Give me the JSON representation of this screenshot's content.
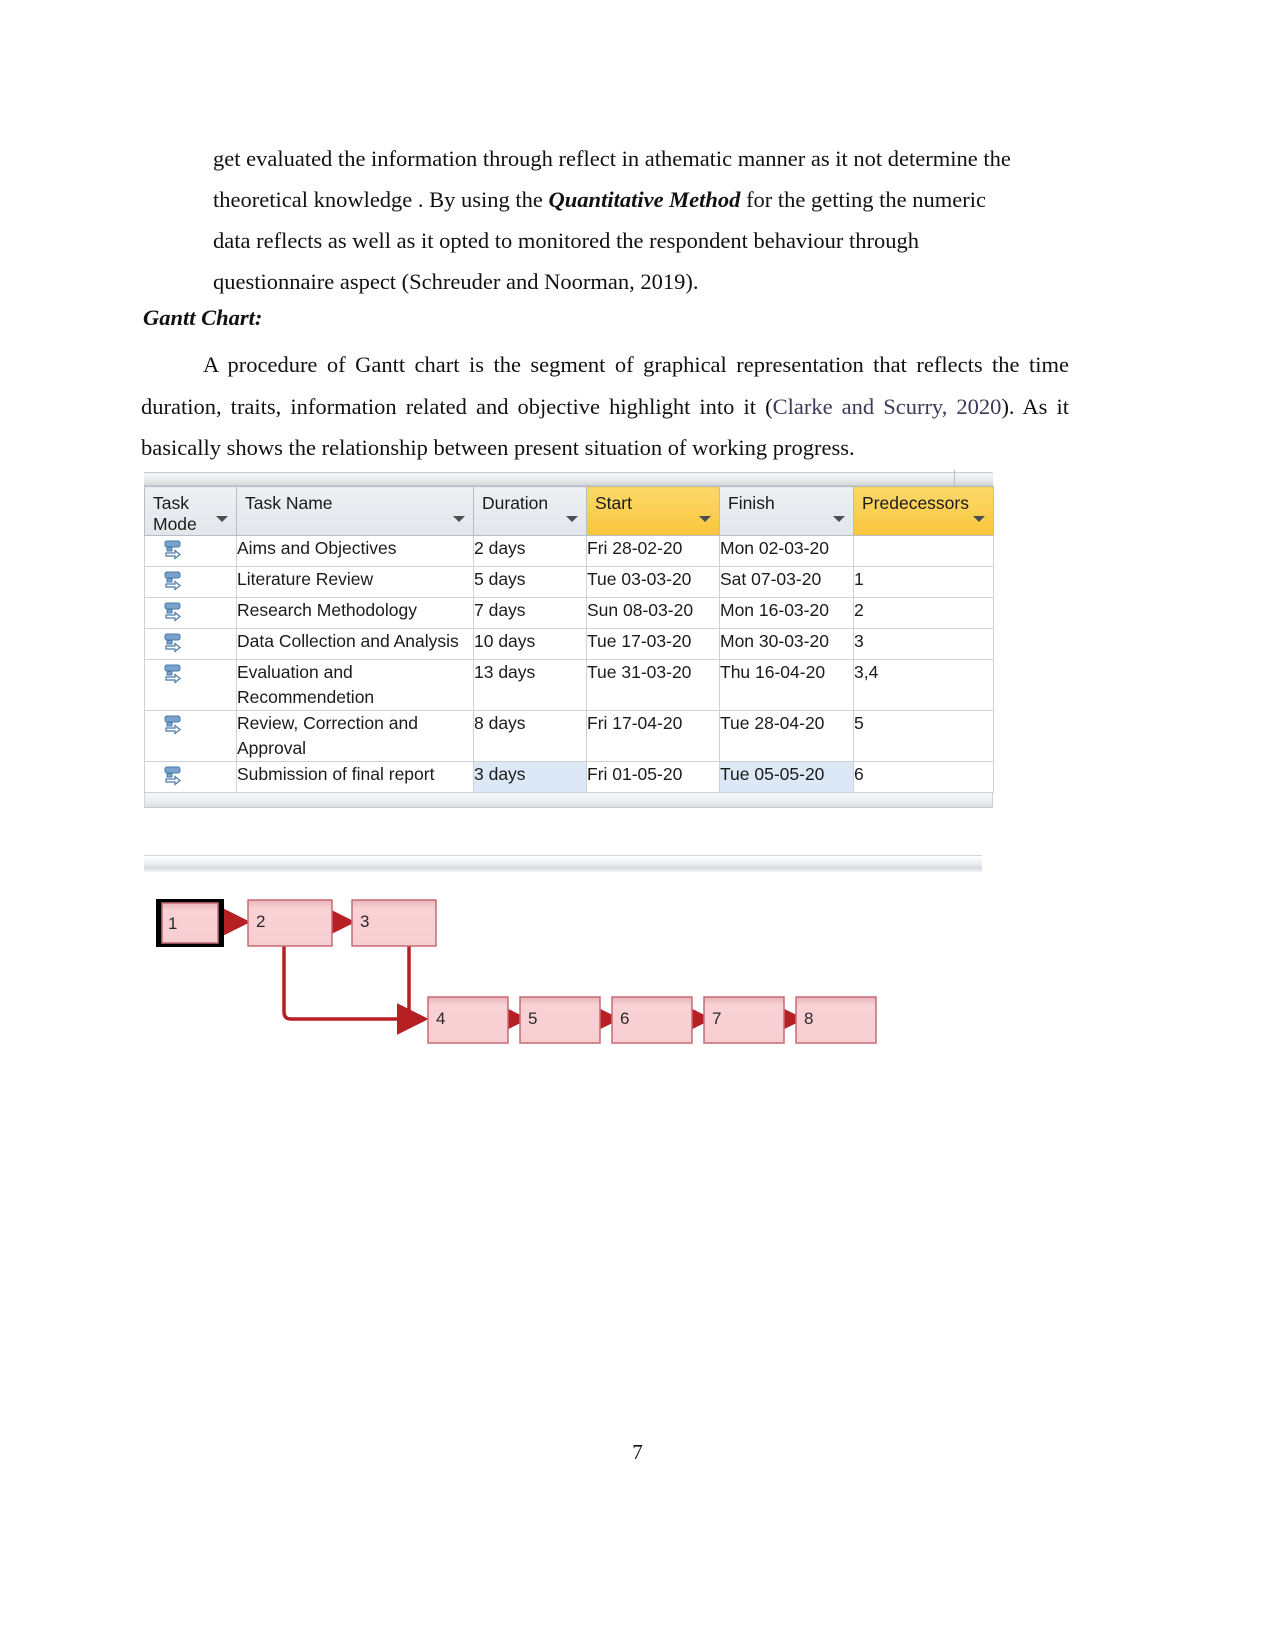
{
  "document": {
    "page_number": "7",
    "paragraph_1": {
      "line_1": "get evaluated the information through reflect in athematic manner as it not determine the",
      "line_2_pre": "theoretical knowledge . By using the ",
      "line_2_bold": "Quantitative Method",
      "line_2_post": " for the getting the numeric",
      "line_3": "data reflects as well as it opted to monitored the respondent behaviour through",
      "line_4": "questionnaire aspect (Schreuder and Noorman, 2019)."
    },
    "heading": "Gantt Chart:",
    "paragraph_2": {
      "text_pre": "A procedure of Gantt chart is the segment of graphical representation that reflects the time duration, traits, information related and objective highlight into it (",
      "citation": "Clarke and Scurry, 2020",
      "text_post": "). As it basically shows the relationship between present situation of working progress."
    }
  },
  "project_table": {
    "columns": [
      {
        "label": "Task\nMode",
        "highlight": false,
        "has_filter": true
      },
      {
        "label": "Task Name",
        "highlight": false,
        "has_filter": true
      },
      {
        "label": "Duration",
        "highlight": false,
        "has_filter": true
      },
      {
        "label": "Start",
        "highlight": true,
        "has_filter": true
      },
      {
        "label": "Finish",
        "highlight": false,
        "has_filter": true
      },
      {
        "label": "Predecessors",
        "highlight": true,
        "has_filter": true
      }
    ],
    "rows": [
      {
        "mode_icon": "auto-schedule-icon",
        "name": "Aims and Objectives",
        "duration": "2 days",
        "start": "Fri 28-02-20",
        "finish": "Mon 02-03-20",
        "predecessors": ""
      },
      {
        "mode_icon": "auto-schedule-icon",
        "name": "Literature Review",
        "duration": "5 days",
        "start": "Tue 03-03-20",
        "finish": "Sat 07-03-20",
        "predecessors": "1"
      },
      {
        "mode_icon": "auto-schedule-icon",
        "name": "Research Methodology",
        "duration": "7 days",
        "start": "Sun 08-03-20",
        "finish": "Mon 16-03-20",
        "predecessors": "2"
      },
      {
        "mode_icon": "auto-schedule-icon",
        "name": "Data Collection and Analysis",
        "duration": "10 days",
        "start": "Tue 17-03-20",
        "finish": "Mon 30-03-20",
        "predecessors": "3"
      },
      {
        "mode_icon": "auto-schedule-icon",
        "name": "Evaluation and Recommendetion",
        "duration": "13 days",
        "start": "Tue 31-03-20",
        "finish": "Thu 16-04-20",
        "predecessors": "3,4"
      },
      {
        "mode_icon": "auto-schedule-icon",
        "name": "Review, Correction and Approval",
        "duration": "8 days",
        "start": "Fri 17-04-20",
        "finish": "Tue 28-04-20",
        "predecessors": "5"
      },
      {
        "mode_icon": "auto-schedule-icon",
        "name": "Submission of final report",
        "duration": "3 days",
        "start": "Fri 01-05-20",
        "finish": "Tue 05-05-20",
        "predecessors": "6",
        "selected_cells": [
          "duration",
          "finish"
        ]
      }
    ]
  },
  "network_diagram": {
    "nodes": [
      {
        "id": "1",
        "label": "1",
        "selected": true
      },
      {
        "id": "2",
        "label": "2",
        "selected": false
      },
      {
        "id": "3",
        "label": "3",
        "selected": false
      },
      {
        "id": "4",
        "label": "4",
        "selected": false
      },
      {
        "id": "5",
        "label": "5",
        "selected": false
      },
      {
        "id": "6",
        "label": "6",
        "selected": false
      },
      {
        "id": "7",
        "label": "7",
        "selected": false
      },
      {
        "id": "8",
        "label": "8",
        "selected": false
      }
    ],
    "links": [
      {
        "from": "1",
        "to": "2"
      },
      {
        "from": "2",
        "to": "3"
      },
      {
        "from": "2",
        "to": "4"
      },
      {
        "from": "3",
        "to": "4"
      },
      {
        "from": "4",
        "to": "5"
      },
      {
        "from": "5",
        "to": "6"
      },
      {
        "from": "6",
        "to": "7"
      },
      {
        "from": "7",
        "to": "8"
      }
    ]
  },
  "colors": {
    "header_highlight": "#f9c63c",
    "header_gray": "#e2e6ea",
    "selection_blue": "#dce8f6",
    "node_fill": "#f7cdd0",
    "node_border": "#c86a74",
    "link_red": "#b61f24",
    "cite_ink": "#3a3a58"
  }
}
